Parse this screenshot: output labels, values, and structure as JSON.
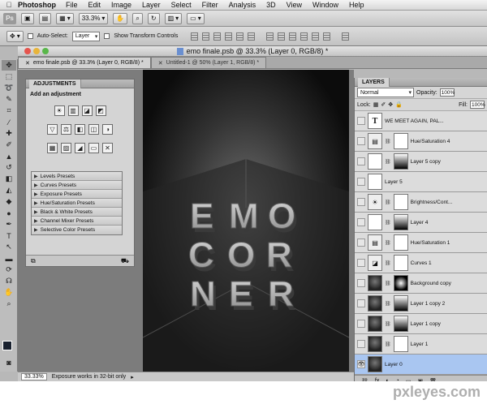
{
  "menubar": {
    "apple": "",
    "app": "Photoshop",
    "items": [
      "File",
      "Edit",
      "Image",
      "Layer",
      "Select",
      "Filter",
      "Analysis",
      "3D",
      "View",
      "Window",
      "Help"
    ]
  },
  "appbar": {
    "logo": "Ps",
    "zoom": "33.3%"
  },
  "options": {
    "auto_select_label": "Auto-Select:",
    "auto_select_value": "Layer",
    "transform_label": "Show Transform Controls"
  },
  "document": {
    "title": "emo finale.psb @ 33.3% (Layer 0, RGB/8) *"
  },
  "tabs": [
    {
      "label": "emo finale.psb @ 33.3% (Layer 0, RGB/8) *",
      "active": true
    },
    {
      "label": "Untitled-1 @ 50% (Layer 1, RGB/8) *",
      "active": false
    }
  ],
  "adjustments": {
    "tab": "ADJUSTMENTS",
    "subtitle": "Add an adjustment",
    "icons_row1": [
      "☀",
      "▥",
      "◪",
      "◩"
    ],
    "icons_row2": [
      "▽",
      "⚖",
      "◧",
      "◫",
      "◑"
    ],
    "icons_row3": [
      "▦",
      "▨",
      "◢",
      "▭",
      "✕"
    ],
    "presets": [
      "Levels Presets",
      "Curves Presets",
      "Exposure Presets",
      "Hue/Saturation Presets",
      "Black & White Presets",
      "Channel Mixer Presets",
      "Selective Color Presets"
    ],
    "footer_left": "⧉",
    "footer_right": "⛟"
  },
  "canvas": {
    "rows": [
      [
        "E",
        "M",
        "O"
      ],
      [
        "C",
        "O",
        "R"
      ],
      [
        "N",
        "E",
        "R"
      ]
    ]
  },
  "layers": {
    "tab": "LAYERS",
    "blend_mode": "Normal",
    "opacity_label": "Opacity:",
    "opacity": "100%",
    "lock_label": "Lock:",
    "fill_label": "Fill:",
    "fill": "100%",
    "items": [
      {
        "name": "WE MEET AGAIN, PAL...",
        "thumb": "T"
      },
      {
        "name": "Hue/Saturation 4",
        "thumb": "▤"
      },
      {
        "name": "Layer 5 copy",
        "thumb": ""
      },
      {
        "name": "Layer 5",
        "thumb": ""
      },
      {
        "name": "Brightness/Cont...",
        "thumb": "☀"
      },
      {
        "name": "Layer 4",
        "thumb": ""
      },
      {
        "name": "Hue/Saturation 1",
        "thumb": "▤"
      },
      {
        "name": "Curves 1",
        "thumb": "◪"
      },
      {
        "name": "Background copy",
        "thumb": ""
      },
      {
        "name": "Layer 1 copy 2",
        "thumb": ""
      },
      {
        "name": "Layer 1 copy",
        "thumb": ""
      },
      {
        "name": "Layer 1",
        "thumb": ""
      },
      {
        "name": "Layer 0",
        "thumb": ""
      }
    ],
    "footer": [
      "⛓",
      "fx",
      "◐",
      "◔",
      "▭",
      "▣",
      "🗑"
    ]
  },
  "status": {
    "zoom": "33.33%",
    "message": "Exposure works in 32-bit only"
  },
  "watermark": "pxleyes.com",
  "colors": {
    "selected_layer": "#a9c6f1",
    "foreground": "#1a2230"
  }
}
